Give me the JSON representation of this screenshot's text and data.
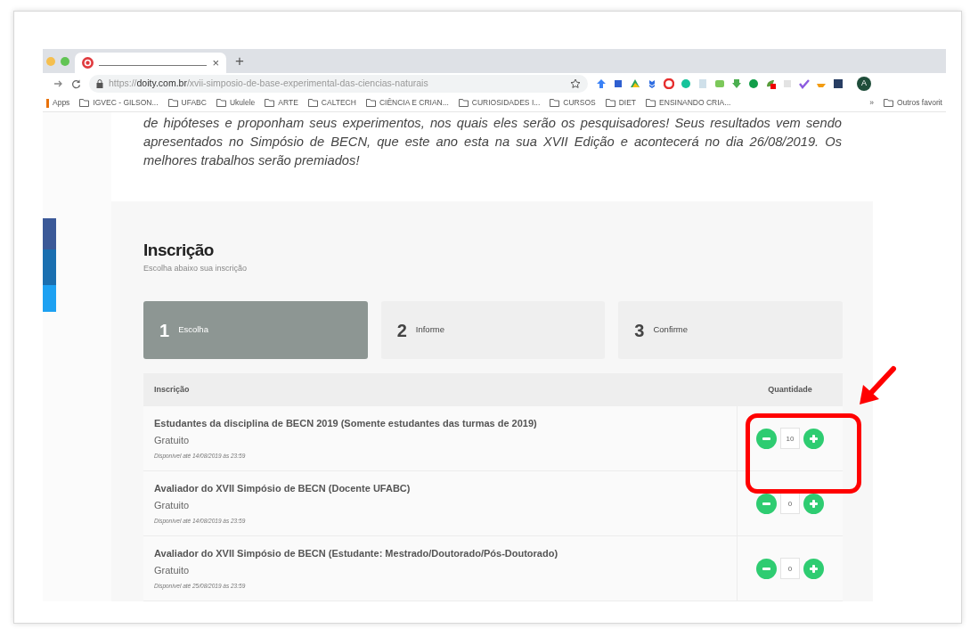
{
  "browser": {
    "tab": {
      "close": "×"
    },
    "new_tab": "+",
    "url": {
      "scheme": "https://",
      "host": "doity.com.br",
      "path": "/xvii-simposio-de-base-experimental-das-ciencias-naturais"
    },
    "profile": "A",
    "bookmarks": [
      {
        "kind": "apps",
        "label": "Apps"
      },
      {
        "kind": "folder",
        "label": "IGVEC - GILSON..."
      },
      {
        "kind": "folder",
        "label": "UFABC"
      },
      {
        "kind": "folder",
        "label": "Ukulele"
      },
      {
        "kind": "folder",
        "label": "ARTE"
      },
      {
        "kind": "folder",
        "label": "CALTECH"
      },
      {
        "kind": "folder",
        "label": "CIÊNCIA E CRIAN..."
      },
      {
        "kind": "folder",
        "label": "CURIOSIDADES I..."
      },
      {
        "kind": "folder",
        "label": "CURSOS"
      },
      {
        "kind": "folder",
        "label": "DIET"
      },
      {
        "kind": "folder",
        "label": "ENSINANDO CRIA..."
      }
    ],
    "bookmarks_overflow": "»",
    "other_bookmarks": "Outros favorit"
  },
  "page": {
    "description": "de hipóteses e proponham seus experimentos, nos quais eles serão os pesquisadores! Seus resultados vem sendo apresentados no Simpósio de BECN, que este ano esta na sua XVII Edição e acontecerá no dia 26/08/2019. Os melhores trabalhos serão premiados!",
    "section_title": "Inscrição",
    "section_subtitle": "Escolha abaixo sua inscrição",
    "steps": [
      {
        "number": "1",
        "label": "Escolha",
        "selected": true
      },
      {
        "number": "2",
        "label": "Informe",
        "selected": false
      },
      {
        "number": "3",
        "label": "Confirme",
        "selected": false
      }
    ],
    "table": {
      "columns": [
        "Inscrição",
        "Quantidade"
      ],
      "rows": [
        {
          "name": "Estudantes da disciplina de BECN 2019 (Somente estudantes das turmas de 2019)",
          "price": "Gratuito",
          "available": "Disponível até 14/08/2019 às 23:59",
          "quantity": "10",
          "highlighted": true
        },
        {
          "name": "Avaliador do XVII Simpósio de BECN (Docente UFABC)",
          "price": "Gratuito",
          "available": "Disponível até 14/08/2019 às 23:59",
          "quantity": "0",
          "highlighted": false
        },
        {
          "name": "Avaliador do XVII Simpósio de BECN (Estudante: Mestrado/Doutorado/Pós-Doutorado)",
          "price": "Gratuito",
          "available": "Disponível até 25/08/2019 às 23:59",
          "quantity": "0",
          "highlighted": false
        }
      ]
    }
  }
}
